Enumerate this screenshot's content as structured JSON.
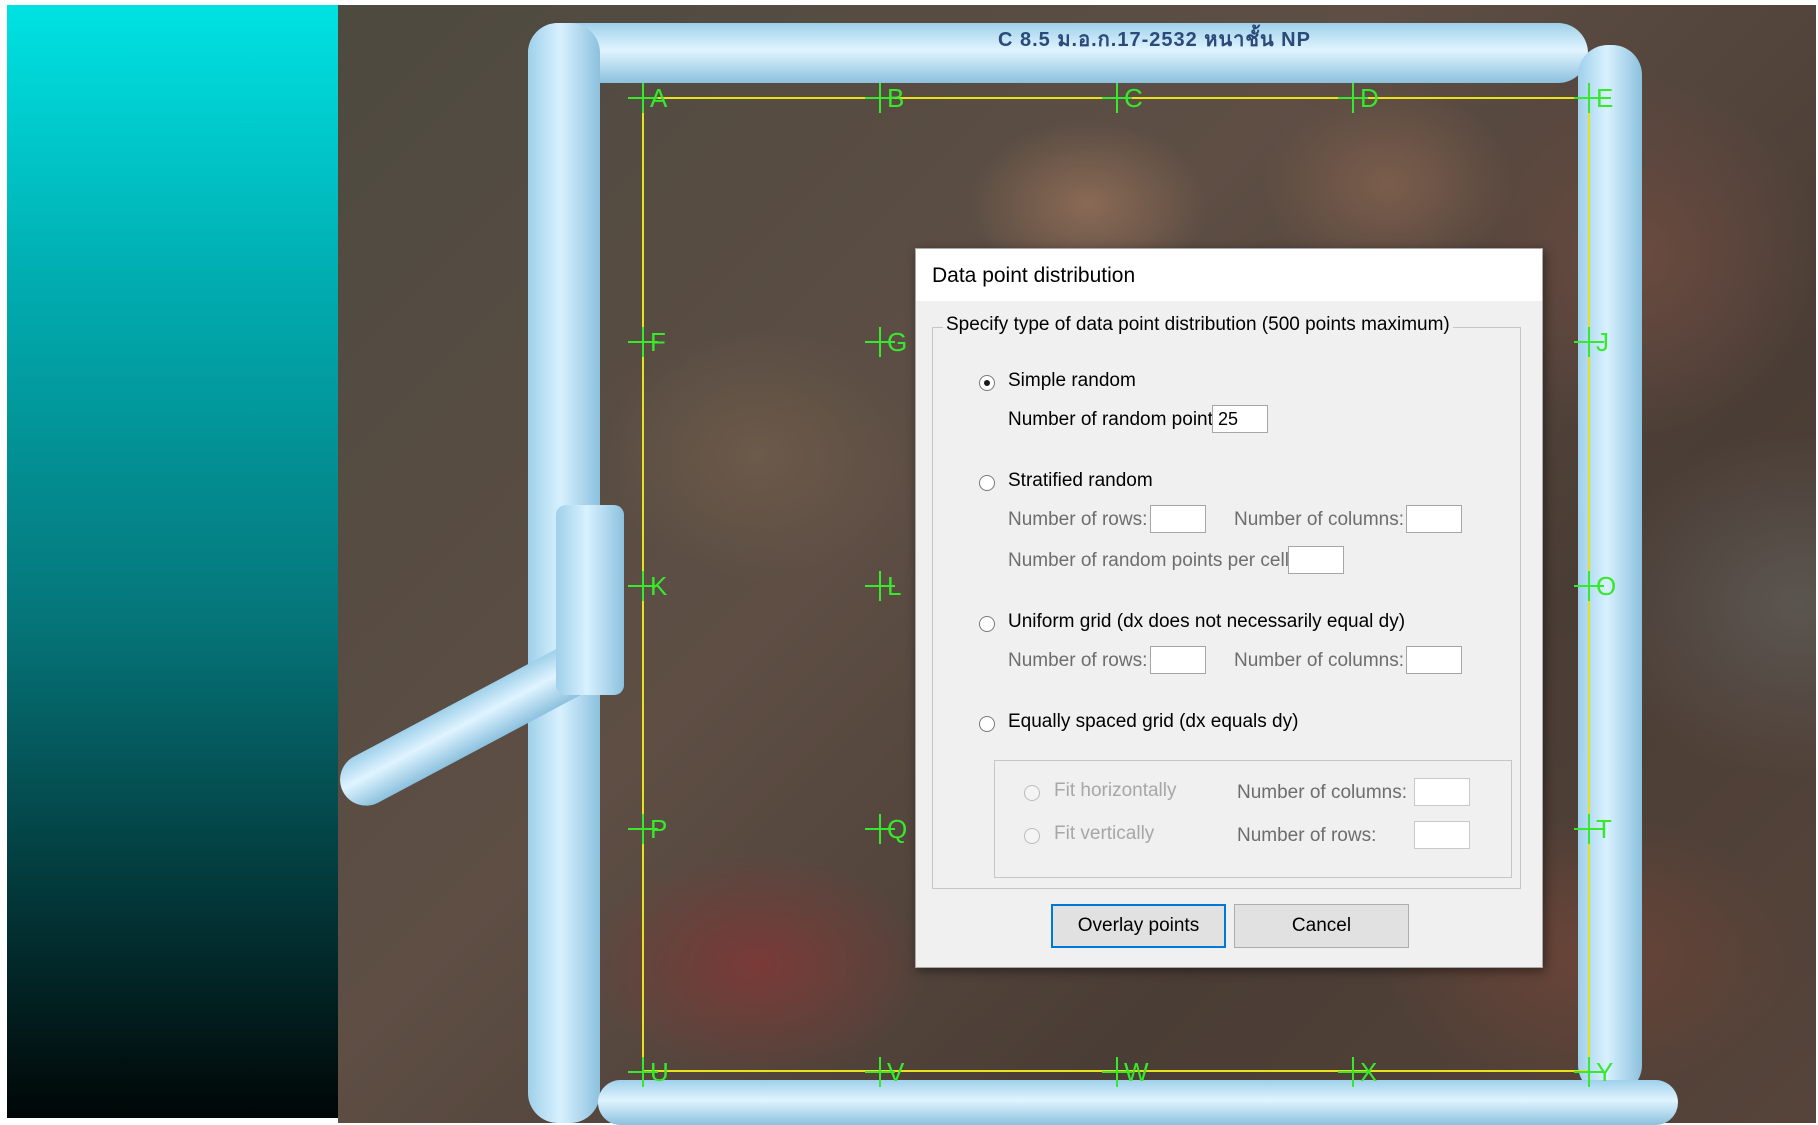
{
  "photo": {
    "pipe_label": "C 8.5 ม.อ.ก.17-2532 หนาชั้น NP",
    "grid_markers": [
      "A",
      "B",
      "C",
      "D",
      "E",
      "F",
      "G",
      "J",
      "K",
      "L",
      "O",
      "P",
      "Q",
      "T",
      "U",
      "V",
      "W",
      "X",
      "Y"
    ]
  },
  "dialog": {
    "title": "Data point distribution",
    "group_label": "Specify type of data point distribution (500 points maximum)",
    "options": {
      "simple_random": {
        "label": "Simple random",
        "selected": true,
        "points_label": "Number of random points:",
        "points_value": "25"
      },
      "stratified_random": {
        "label": "Stratified random",
        "rows_label": "Number of rows:",
        "columns_label": "Number of columns:",
        "per_cell_label": "Number of random points per cell:",
        "rows_value": "",
        "columns_value": "",
        "per_cell_value": ""
      },
      "uniform_grid": {
        "label": "Uniform grid (dx does not necessarily equal dy)",
        "rows_label": "Number of rows:",
        "columns_label": "Number of columns:",
        "rows_value": "",
        "columns_value": ""
      },
      "equal_grid": {
        "label": "Equally spaced grid (dx equals dy)",
        "fit_horizontally": "Fit horizontally",
        "fit_vertically": "Fit vertically",
        "columns_label": "Number of columns:",
        "rows_label": "Number of rows:",
        "columns_value": "",
        "rows_value": ""
      }
    },
    "buttons": {
      "overlay": "Overlay points",
      "cancel": "Cancel"
    }
  },
  "colors": {
    "marker": "#37e82c",
    "gridline": "#e8e21c",
    "pipe": "#bfe4f7"
  }
}
